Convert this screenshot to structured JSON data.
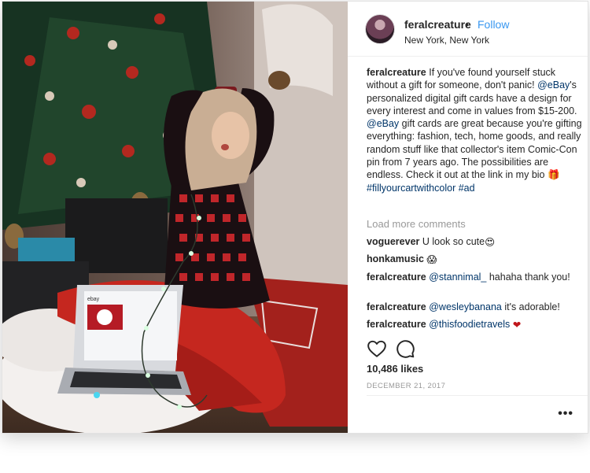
{
  "post": {
    "username": "feralcreature",
    "separator": "•",
    "follow_label": "Follow",
    "location": "New York, New York",
    "caption": {
      "username": "feralcreature",
      "text_1": " If you've found yourself stuck without a gift for someone, don't panic! ",
      "mention_1": "@eBay",
      "text_2": "'s personalized digital gift cards have a design for every interest and come in values from $15-200. ",
      "mention_2": "@eBay",
      "text_3": " gift cards are great because you're gifting everything: fashion, tech, home goods, and really random stuff like that collector's item Comic-Con pin from 7 years ago. The possibilities are endless. Check it out at the link in my bio ",
      "emoji": "🎁",
      "hashtag_1": "#fillyourcartwithcolor",
      "hashtag_2": "#ad"
    },
    "load_more_label": "Load more comments",
    "comments": [
      {
        "user": "voguerever",
        "text": " U look so cute",
        "emoji": "😍"
      },
      {
        "user": "honkamusic",
        "text": " ",
        "emoji": "😱"
      },
      {
        "user": "feralcreature",
        "mention": "@stannimal_",
        "text": " hahaha thank you!"
      },
      {
        "user": "feralcreature",
        "mention": "@wesleybanana",
        "text": " it's adorable!"
      },
      {
        "user": "feralcreature",
        "mention": "@thisfoodietravels",
        "text": " ",
        "emoji": "❤"
      }
    ],
    "likes": "10,486 likes",
    "date": "DECEMBER 21, 2017",
    "more_label": "•••"
  },
  "photo": {
    "laptop_screen_brand": "ebay"
  },
  "colors": {
    "link_blue": "#3897f0",
    "tag_blue": "#003569",
    "muted": "#999999",
    "heart_red": "#c0161b"
  },
  "icons": [
    "heart-icon",
    "comment-icon",
    "more-options-icon"
  ]
}
